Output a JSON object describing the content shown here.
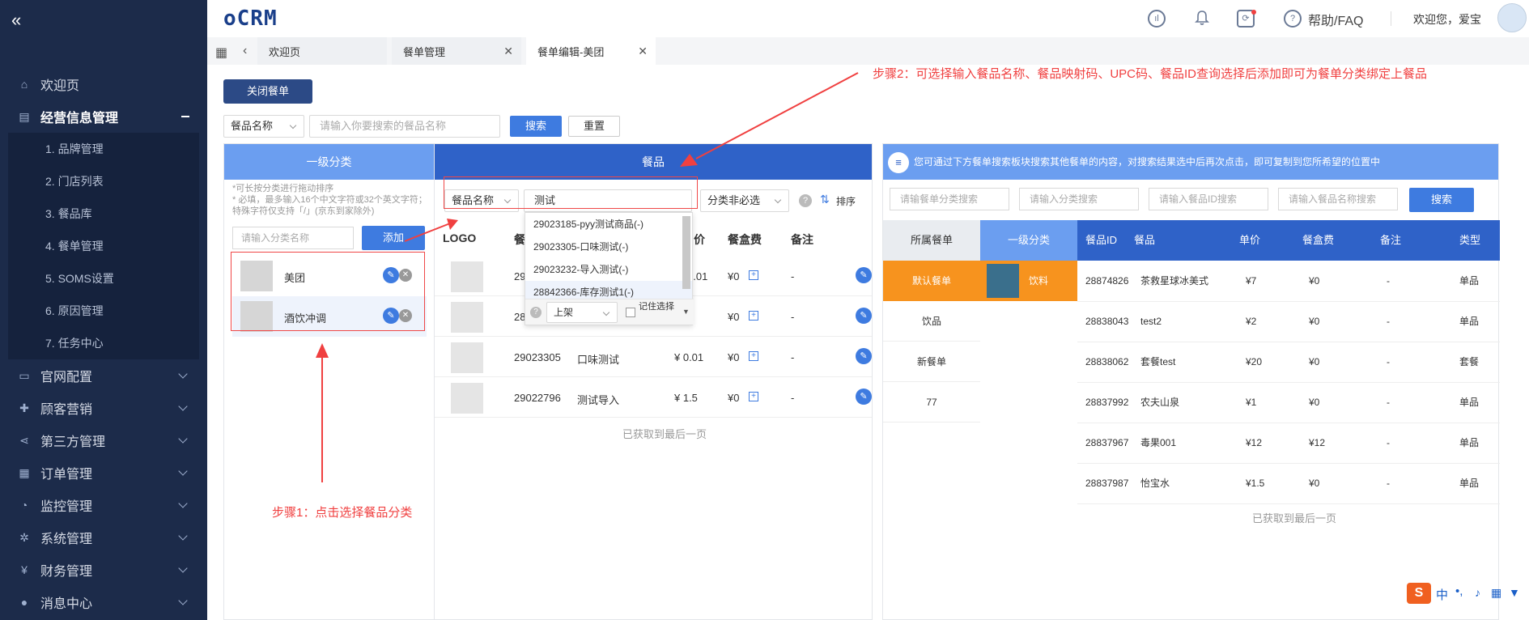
{
  "sidebar": {
    "collapse_icon": "«",
    "items": [
      {
        "label": "欢迎页",
        "icon": "home-icon"
      },
      {
        "label": "经营信息管理",
        "icon": "store-icon",
        "expanded": true
      },
      {
        "label": "官网配置",
        "icon": "monitor-icon"
      },
      {
        "label": "顾客营销",
        "icon": "gift-icon"
      },
      {
        "label": "第三方管理",
        "icon": "share-icon"
      },
      {
        "label": "订单管理",
        "icon": "order-icon"
      },
      {
        "label": "监控管理",
        "icon": "monitor-chart-icon"
      },
      {
        "label": "系统管理",
        "icon": "gear-icon"
      },
      {
        "label": "财务管理",
        "icon": "yen-icon"
      },
      {
        "label": "消息中心",
        "icon": "message-icon"
      }
    ],
    "sub_items": [
      "1. 品牌管理",
      "2. 门店列表",
      "3. 餐品库",
      "4. 餐单管理",
      "5. SOMS设置",
      "6. 原因管理",
      "7. 任务中心"
    ]
  },
  "header": {
    "logo": "oCRM",
    "help": "帮助/FAQ",
    "welcome": "欢迎您，爱宝"
  },
  "tabs": [
    {
      "label": "欢迎页"
    },
    {
      "label": "餐单管理"
    },
    {
      "label": "餐单编辑-美团"
    }
  ],
  "toolbar": {
    "close_menu": "关闭餐单",
    "search_type": "餐品名称",
    "search_placeholder": "请输入你要搜索的餐品名称",
    "search": "搜索",
    "reset": "重置"
  },
  "category": {
    "header": "一级分类",
    "hint": "*可长按分类进行拖动排序\n* 必填，最多输入16个中文字符或32个英文字符；特殊字符仅支持「/」(京东到家除外)",
    "input_placeholder": "请输入分类名称",
    "add": "添加",
    "rows": [
      {
        "name": "美团"
      },
      {
        "name": "酒饮冲调"
      }
    ]
  },
  "dish": {
    "header": "餐品",
    "search_type": "餐品名称",
    "search_value": "测试",
    "filter": "分类非必选",
    "sort": "排序",
    "col_logo": "LOGO",
    "col_name_partial": "餐",
    "col_price_partial": "价",
    "col_box": "餐盒费",
    "col_note": "备注",
    "rows": [
      {
        "id": "29",
        "name": "",
        "price": "0.01",
        "box": "¥0",
        "note": "-"
      },
      {
        "id": "28",
        "name": "",
        "price": "",
        "box": "¥0",
        "note": "-"
      },
      {
        "id": "29023305",
        "name": "口味测试",
        "price": "¥ 0.01",
        "box": "¥0",
        "note": "-"
      },
      {
        "id": "29022796",
        "name": "测试导入",
        "price": "¥ 1.5",
        "box": "¥0",
        "note": "-"
      }
    ],
    "footer": "已获取到最后一页"
  },
  "dropdown": {
    "items": [
      "29023185-pyy测试商品(-)",
      "29023305-口味测试(-)",
      "29023232-导入测试(-)",
      "28842366-库存测试1(-)"
    ],
    "status": "上架",
    "remember": "记住选择"
  },
  "right": {
    "header": "您可通过下方餐单搜索板块搜索其他餐单的内容，对搜索结果选中后再次点击，即可复制到您所希望的位置中",
    "inputs": [
      "请输餐单分类搜索",
      "请输入分类搜索",
      "请输入餐品ID搜索",
      "请输入餐品名称搜索"
    ],
    "search": "搜索",
    "cols": [
      "所属餐单",
      "一级分类",
      "餐品ID",
      "餐品",
      "单价",
      "餐盒费",
      "备注",
      "类型"
    ],
    "menus": [
      "默认餐单",
      "饮品",
      "新餐单",
      "77"
    ],
    "category": "饮料",
    "rows": [
      {
        "id": "28874826",
        "name": "茶救星球冰美式",
        "price": "¥7",
        "box": "¥0",
        "note": "-",
        "type": "单品"
      },
      {
        "id": "28838043",
        "name": "test2",
        "price": "¥2",
        "box": "¥0",
        "note": "-",
        "type": "单品"
      },
      {
        "id": "28838062",
        "name": "套餐test",
        "price": "¥20",
        "box": "¥0",
        "note": "-",
        "type": "套餐"
      },
      {
        "id": "28837992",
        "name": "农夫山泉",
        "price": "¥1",
        "box": "¥0",
        "note": "-",
        "type": "单品"
      },
      {
        "id": "28837967",
        "name": "毒果001",
        "price": "¥12",
        "box": "¥12",
        "note": "-",
        "type": "单品"
      },
      {
        "id": "28837987",
        "name": "怡宝水",
        "price": "¥1.5",
        "box": "¥0",
        "note": "-",
        "type": "单品"
      }
    ],
    "footer": "已获取到最后一页"
  },
  "annotations": {
    "step1": "步骤1：点击选择餐品分类",
    "step2": "步骤2：可选择输入餐品名称、餐品映射码、UPC码、餐品ID查询选择后添加即可为餐单分类绑定上餐品"
  },
  "colors": {
    "sidebar": "#1c2b4a",
    "primary": "#3e7be0",
    "head_light": "#6b9ef0",
    "head_dark": "#2f62c8",
    "orange": "#f7931e",
    "annotation": "#f04040"
  }
}
